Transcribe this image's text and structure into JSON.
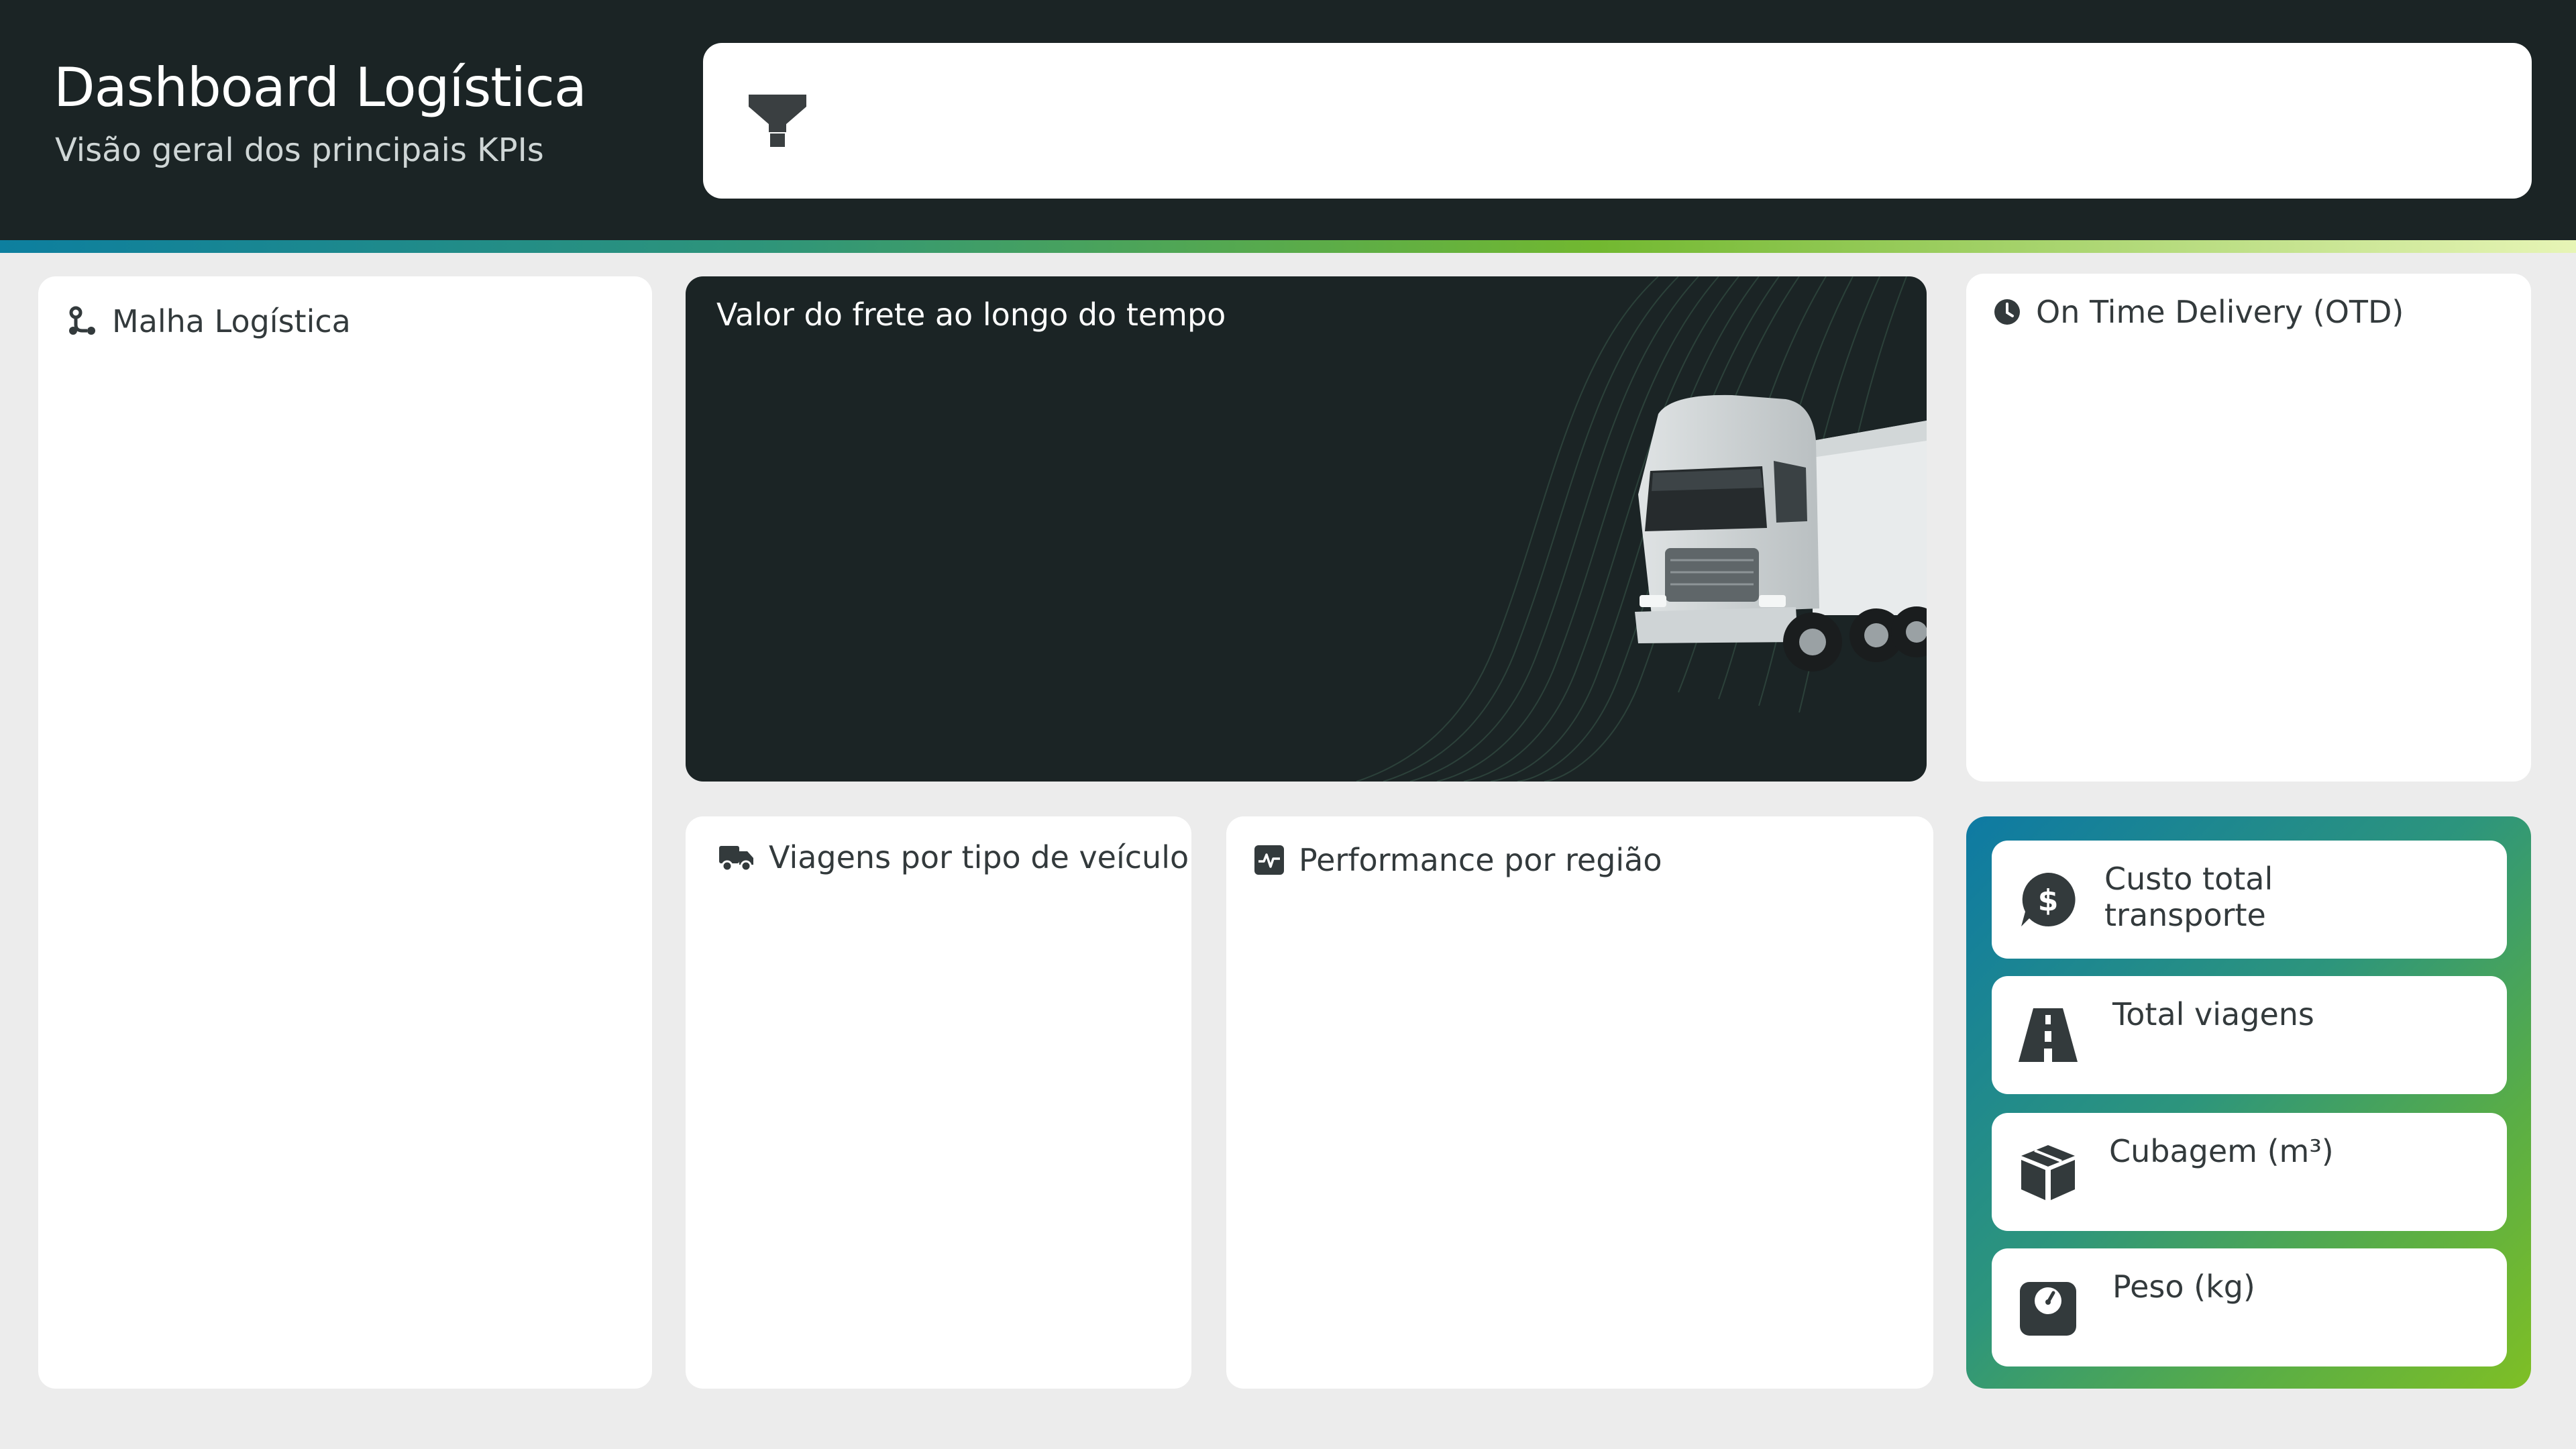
{
  "header": {
    "title": "Dashboard Logística",
    "subtitle": "Visão geral dos principais KPIs"
  },
  "filter_bar": {
    "icon": "filter-icon"
  },
  "cards": {
    "malha": {
      "title": "Malha Logística",
      "icon": "route-icon"
    },
    "frete": {
      "title": "Valor do frete ao longo do tempo",
      "image": "white-truck"
    },
    "otd": {
      "title": "On Time Delivery (OTD)",
      "icon": "clock-icon"
    },
    "viagens": {
      "title": "Viagens por tipo de veículo",
      "icon": "truck-icon"
    },
    "performance": {
      "title": "Performance por região",
      "icon": "pulse-icon"
    }
  },
  "kpis": [
    {
      "label": "Custo total transporte",
      "icon": "dollar-chat-icon"
    },
    {
      "label": "Total viagens",
      "icon": "road-icon"
    },
    {
      "label": "Cubagem (m³)",
      "icon": "box-icon"
    },
    {
      "label": "Peso (kg)",
      "icon": "scale-icon"
    }
  ],
  "colors": {
    "header_bg": "#1b2425",
    "page_bg": "#ececec",
    "accent_blue": "#0e7aa3",
    "accent_green": "#7fbf25"
  }
}
